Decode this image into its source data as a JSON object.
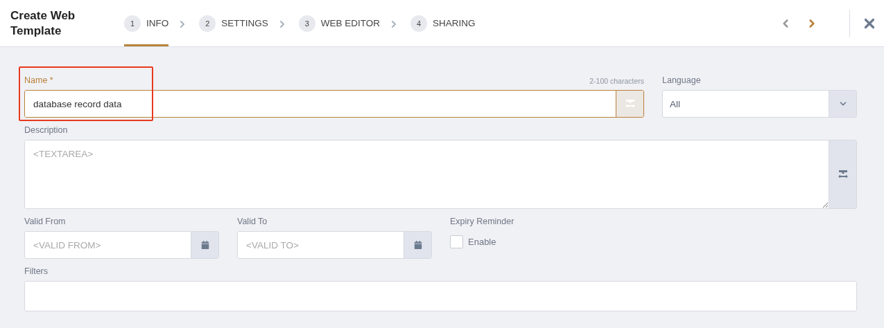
{
  "header": {
    "title": "Create Web Template",
    "steps": [
      {
        "number": "1",
        "label": "INFO",
        "selected": true
      },
      {
        "number": "2",
        "label": "SETTINGS",
        "selected": false
      },
      {
        "number": "3",
        "label": "WEB EDITOR",
        "selected": false
      },
      {
        "number": "4",
        "label": "SHARING",
        "selected": false
      }
    ],
    "prev": {
      "disabled": true
    },
    "next": {
      "disabled": false
    }
  },
  "form": {
    "name": {
      "label": "Name *",
      "hint": "2-100 characters",
      "value": "database record data",
      "focused": true,
      "highlighted": true
    },
    "language": {
      "label": "Language",
      "value": "All"
    },
    "description": {
      "label": "Description",
      "placeholder": "<TEXTAREA>"
    },
    "valid_from": {
      "label": "Valid From",
      "placeholder": "<VALID FROM>"
    },
    "valid_to": {
      "label": "Valid To",
      "placeholder": "<VALID TO>"
    },
    "expiry": {
      "label": "Expiry Reminder",
      "option": "Enable",
      "checked": false
    },
    "filters": {
      "label": "Filters"
    }
  }
}
